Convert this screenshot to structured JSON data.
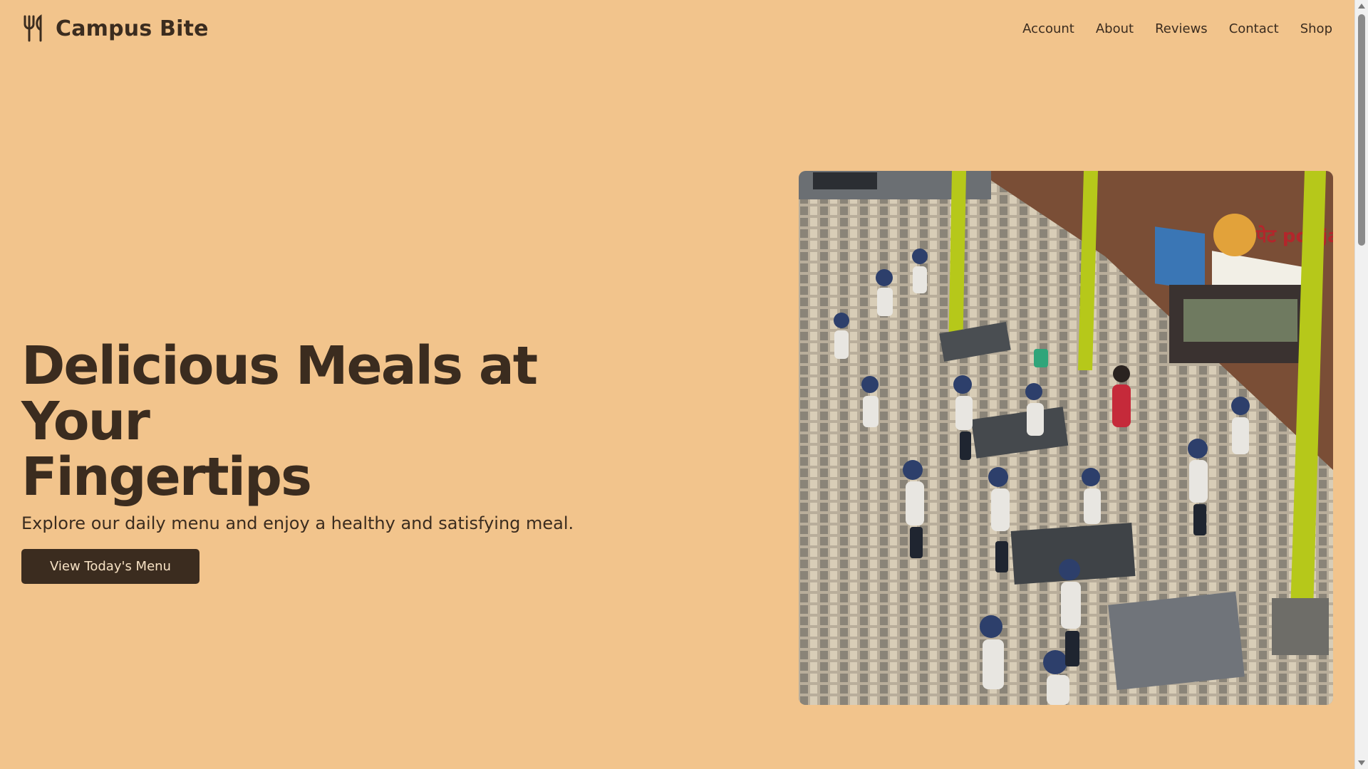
{
  "brand": {
    "name": "Campus Bite",
    "icon": "fork-knife-icon"
  },
  "nav": {
    "items": [
      "Account",
      "About",
      "Reviews",
      "Contact",
      "Shop"
    ]
  },
  "hero": {
    "title_line1": "Delicious Meals at Your",
    "title_line2": "Fingertips",
    "subtitle": "Explore our daily menu and enjoy a healthy and satisfying meal.",
    "cta_label": "View Today's Menu"
  },
  "photo": {
    "sign_text": "पेट pooja",
    "alt": "Students gathered at a campus food court"
  },
  "colors": {
    "background": "#f2c48c",
    "text": "#3b2c1f",
    "button": "#3b2c1f",
    "button_text": "#f7e2c4"
  }
}
